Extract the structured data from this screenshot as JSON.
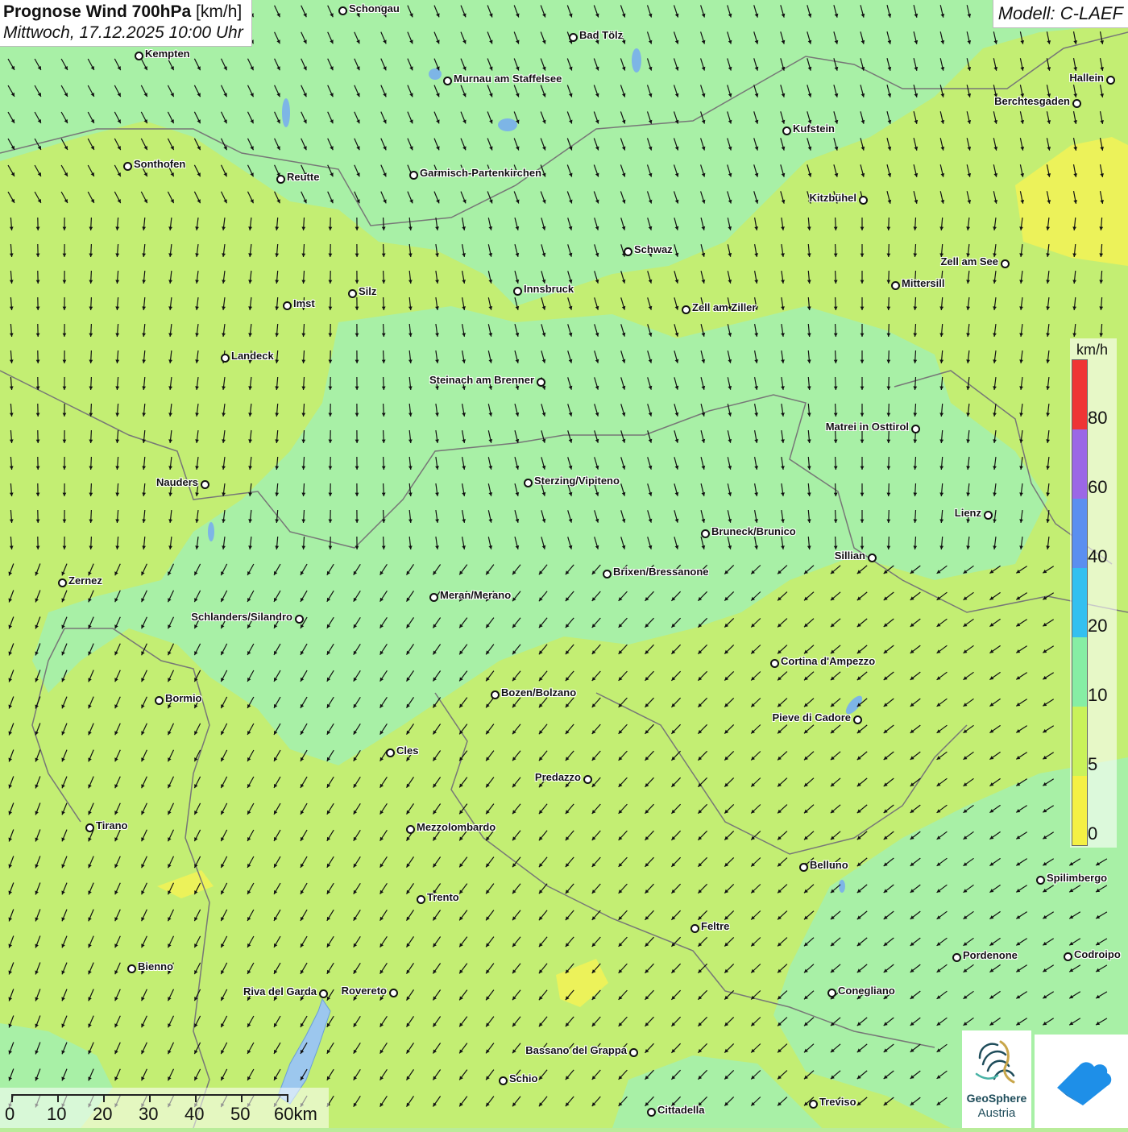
{
  "title": {
    "main": "Prognose Wind 700hPa",
    "unit": "[km/h]",
    "datetime": "Mittwoch, 17.12.2025 10:00 Uhr"
  },
  "model": "Modell: C-LAEF",
  "legend": {
    "unit": "km/h",
    "labels": [
      "80",
      "60",
      "40",
      "20",
      "10",
      "5",
      "0"
    ],
    "colors": [
      "#ef3535",
      "#9b67e6",
      "#5b8ff0",
      "#33c0f0",
      "#86eea4",
      "#c9f25a",
      "#f4f044"
    ]
  },
  "scale": {
    "labels": [
      "0",
      "10",
      "20",
      "30",
      "40",
      "50",
      "60km"
    ]
  },
  "logos": {
    "geosphere_line1": "GeoSphere",
    "geosphere_line2": "Austria"
  },
  "cities": [
    {
      "name": "Schongau"
    },
    {
      "name": "Bad Tölz"
    },
    {
      "name": "Kempten"
    },
    {
      "name": "Murnau am Staffelsee"
    },
    {
      "name": "Hallein"
    },
    {
      "name": "Berchtesgaden"
    },
    {
      "name": "Kufstein"
    },
    {
      "name": "Sonthofen"
    },
    {
      "name": "Reutte"
    },
    {
      "name": "Garmisch-Partenkirchen"
    },
    {
      "name": "Kitzbühel"
    },
    {
      "name": "Schwaz"
    },
    {
      "name": "Zell am See"
    },
    {
      "name": "Mittersill"
    },
    {
      "name": "Innsbruck"
    },
    {
      "name": "Silz"
    },
    {
      "name": "Imst"
    },
    {
      "name": "Zell am Ziller"
    },
    {
      "name": "Landeck"
    },
    {
      "name": "Steinach am Brenner"
    },
    {
      "name": "Matrei in Osttirol"
    },
    {
      "name": "Nauders"
    },
    {
      "name": "Sterzing/Vipiteno"
    },
    {
      "name": "Lienz"
    },
    {
      "name": "Bruneck/Brunico"
    },
    {
      "name": "Sillian"
    },
    {
      "name": "Zernez"
    },
    {
      "name": "Brixen/Bressanone"
    },
    {
      "name": "Meran/Merano"
    },
    {
      "name": "Schlanders/Silandro"
    },
    {
      "name": "Cortina d'Ampezzo"
    },
    {
      "name": "Bozen/Bolzano"
    },
    {
      "name": "Bormio"
    },
    {
      "name": "Pieve di Cadore"
    },
    {
      "name": "Cles"
    },
    {
      "name": "Predazzo"
    },
    {
      "name": "Tirano"
    },
    {
      "name": "Mezzolombardo"
    },
    {
      "name": "Belluno"
    },
    {
      "name": "Spilimbergo"
    },
    {
      "name": "Trento"
    },
    {
      "name": "Feltre"
    },
    {
      "name": "Pordenone"
    },
    {
      "name": "Codroipo"
    },
    {
      "name": "Bienno"
    },
    {
      "name": "Riva del Garda"
    },
    {
      "name": "Rovereto"
    },
    {
      "name": "Conegliano"
    },
    {
      "name": "Bassano del Grappa"
    },
    {
      "name": "Schio"
    },
    {
      "name": "Treviso"
    },
    {
      "name": "Cittadella"
    }
  ]
}
